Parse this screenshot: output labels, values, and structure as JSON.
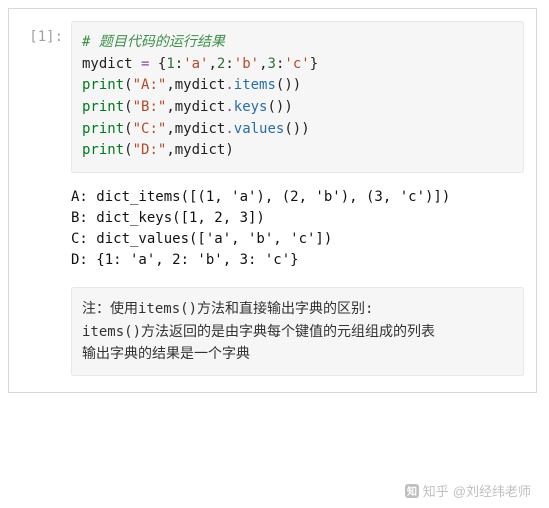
{
  "prompt": "[1]:",
  "code": {
    "line1_comment": "# 题目代码的运行结果",
    "line2": {
      "name": "mydict ",
      "op": "=",
      "rest_open": " {",
      "k1": "1",
      "c": ":",
      "v1": "'a'",
      "sep": ",",
      "k2": "2",
      "v2": "'b'",
      "k3": "3",
      "v3": "'c'",
      "close": "}"
    },
    "line3": {
      "print": "print",
      "open": "(",
      "s": "\"A:\"",
      "sep": ",",
      "obj": "mydict",
      "dot": ".",
      "meth": "items",
      "call": "())"
    },
    "line4": {
      "print": "print",
      "open": "(",
      "s": "\"B:\"",
      "sep": ",",
      "obj": "mydict",
      "dot": ".",
      "meth": "keys",
      "call": "())"
    },
    "line5": {
      "print": "print",
      "open": "(",
      "s": "\"C:\"",
      "sep": ",",
      "obj": "mydict",
      "dot": ".",
      "meth": "values",
      "call": "())"
    },
    "line6": {
      "print": "print",
      "open": "(",
      "s": "\"D:\"",
      "sep": ",",
      "obj": "mydict",
      "close": ")"
    }
  },
  "output": {
    "l1": "A: dict_items([(1, 'a'), (2, 'b'), (3, 'c')])",
    "l2": "B: dict_keys([1, 2, 3])",
    "l3": "C: dict_values(['a', 'b', 'c'])",
    "l4": "D: {1: 'a', 2: 'b', 3: 'c'}"
  },
  "note": {
    "l1": "注：使用items()方法和直接输出字典的区别:",
    "l2": "items()方法返回的是由字典每个键值的元组组成的列表",
    "l3": "输出字典的结果是一个字典"
  },
  "watermark": {
    "brand": "知乎",
    "author": "@刘经纬老师"
  }
}
